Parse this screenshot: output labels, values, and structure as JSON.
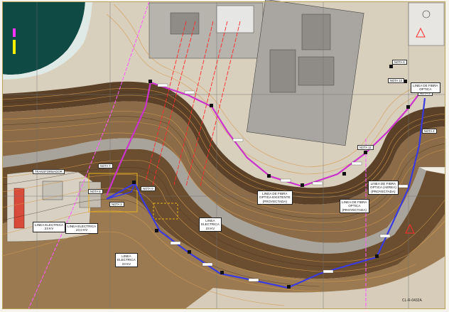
{
  "map": {
    "colors": {
      "paper": "#f6f3ec",
      "ocean": "#0f4a44",
      "surf": "#dfe9e6",
      "terrain_dark": "#4a3623",
      "terrain_mid": "#8a6a45",
      "contour": "#c79a55",
      "sand": "#d8cfbe",
      "road": "#9a9690",
      "plant": "#b9b6b0",
      "fiber_existing": "#cc33cc",
      "fiber_projected": "#3333dd",
      "power_line": "#ff2a2a",
      "grid": "#7a7a7a",
      "boundary": "#ff66ff",
      "study_area": "#e6b21a"
    },
    "labels": {
      "transformador": "TRANSFORMADOR",
      "nota7": "NOTA 7",
      "nota8": "NOTA 8",
      "nota9": "NOTA 9",
      "nota3": "NOTA 3",
      "nota10": "NOTA 10",
      "nota11": "NOTA 11",
      "nota6": "NOTA 6",
      "nota5": "NOTA 5",
      "nota4": "NOTA 4",
      "linea_fibra_ex": "LINEA DE FIBRA\nOPTICA EXISTENTE\n(PROYECTADA)",
      "linea_fibra_opt": "LINEA DE FIBRA\nOPTICA",
      "linea_fibra_aerea": "LINEA DE FIBRA\nOPTICA (AEREA)\n(PROYECTADA)",
      "linea_fibra_sub": "LINEA DE FIBRA\nOPTICA\n(PROYECTADA)",
      "linea_elec_a": "LINEA ELECTRICA\n23,0 KV",
      "linea_elec_b": "LINEA ELECTRICA\n23 KV",
      "linea_elec_c": "LINEA\nELECTRICA\n23 KV",
      "linea_elec_d": "LINEA\nELECTRICA\n23 KV",
      "bottom_ref": "CL-R-0432A"
    }
  }
}
